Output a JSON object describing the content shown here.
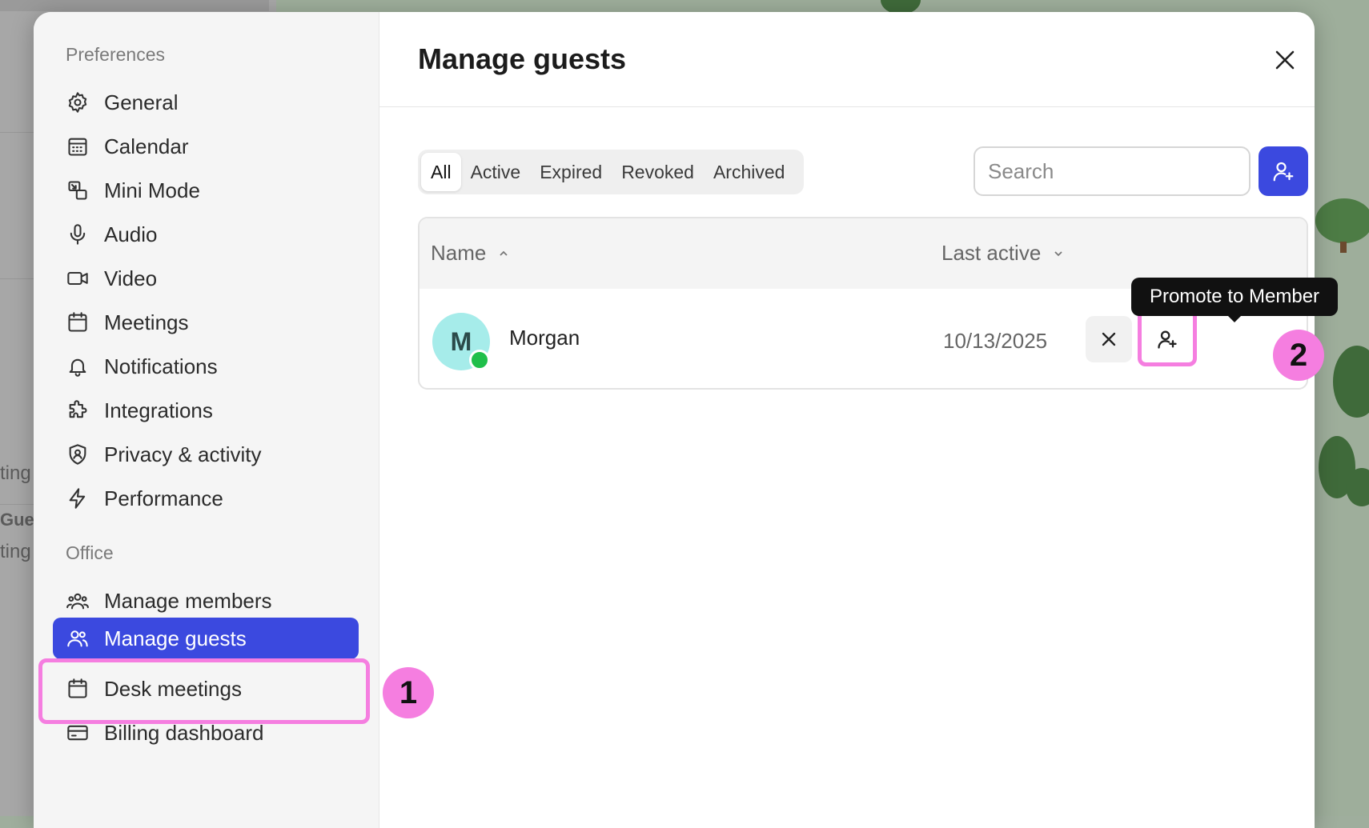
{
  "background": {
    "fragments": [
      "ting",
      "Gues",
      "ting"
    ]
  },
  "sidebar": {
    "preferences_label": "Preferences",
    "preferences_items": [
      {
        "label": "General",
        "icon": "gear-icon"
      },
      {
        "label": "Calendar",
        "icon": "calendar-grid-icon"
      },
      {
        "label": "Mini Mode",
        "icon": "mini-mode-icon"
      },
      {
        "label": "Audio",
        "icon": "microphone-icon"
      },
      {
        "label": "Video",
        "icon": "video-camera-icon"
      },
      {
        "label": "Meetings",
        "icon": "calendar-icon"
      },
      {
        "label": "Notifications",
        "icon": "bell-icon"
      },
      {
        "label": "Integrations",
        "icon": "puzzle-icon"
      },
      {
        "label": "Privacy & activity",
        "icon": "shield-user-icon"
      },
      {
        "label": "Performance",
        "icon": "lightning-icon"
      }
    ],
    "office_label": "Office",
    "office_items": [
      {
        "label": "Manage members",
        "icon": "members-icon"
      },
      {
        "label": "Manage guests",
        "icon": "guests-icon",
        "active": true
      },
      {
        "label": "Desk meetings",
        "icon": "calendar-icon"
      },
      {
        "label": "Billing dashboard",
        "icon": "credit-card-icon"
      }
    ]
  },
  "main": {
    "title": "Manage guests",
    "tabs": [
      "All",
      "Active",
      "Expired",
      "Revoked",
      "Archived"
    ],
    "active_tab": "All",
    "search": {
      "placeholder": "Search",
      "value": ""
    },
    "table": {
      "columns": [
        {
          "label": "Name",
          "sort": "ascending"
        },
        {
          "label": "Last active",
          "sort": "descending"
        }
      ],
      "rows": [
        {
          "initial": "M",
          "name": "Morgan",
          "last_active": "10/13/2025",
          "online": true
        }
      ]
    },
    "tooltip": "Promote to Member"
  },
  "annotations": {
    "step1": "1",
    "step2": "2",
    "highlight_color": "#f57ee0"
  },
  "colors": {
    "accent": "#3b49df",
    "online": "#1fbf4a",
    "avatar_bg": "#a6ecea"
  }
}
